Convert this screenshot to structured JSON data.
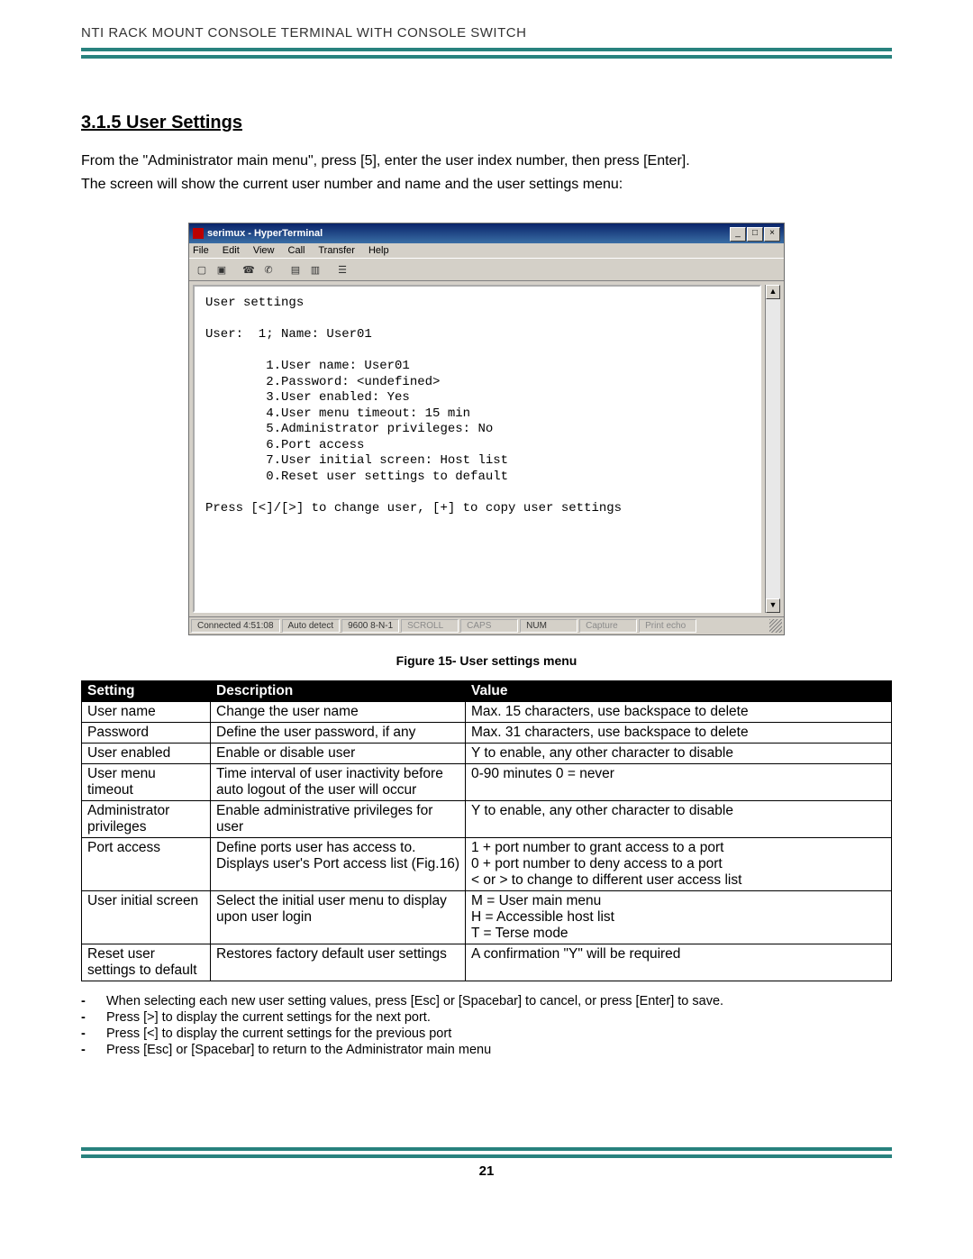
{
  "header": "NTI RACK MOUNT CONSOLE TERMINAL WITH CONSOLE SWITCH",
  "section_heading": "3.1.5 User Settings",
  "intro_line1": "From the \"Administrator main menu\", press [5], enter the user index number, then press [Enter].",
  "intro_line2": "The screen will show the current user number and name and the user settings menu:",
  "hyperterminal": {
    "title": "serimux - HyperTerminal",
    "menu": {
      "file": "File",
      "edit": "Edit",
      "view": "View",
      "call": "Call",
      "transfer": "Transfer",
      "help": "Help"
    },
    "terminal_text": "User settings\n\nUser:  1; Name: User01\n\n        1.User name: User01\n        2.Password: <undefined>\n        3.User enabled: Yes\n        4.User menu timeout: 15 min\n        5.Administrator privileges: No\n        6.Port access\n        7.User initial screen: Host list\n        0.Reset user settings to default\n\nPress [<]/[>] to change user, [+] to copy user settings",
    "status": {
      "connected": "Connected 4:51:08",
      "autodetect": "Auto detect",
      "baud": "9600 8-N-1",
      "scroll": "SCROLL",
      "caps": "CAPS",
      "num": "NUM",
      "capture": "Capture",
      "printecho": "Print echo"
    }
  },
  "figure_caption": "Figure 15- User settings menu",
  "table_header": {
    "c1": "Setting",
    "c2": "Description",
    "c3": "Value"
  },
  "rows": [
    {
      "setting": "User name",
      "desc": "Change the user name",
      "value": "Max. 15 characters, use backspace to delete"
    },
    {
      "setting": "Password",
      "desc": "Define the user password, if any",
      "value": "Max. 31 characters, use backspace to delete"
    },
    {
      "setting": "User enabled",
      "desc": "Enable or disable user",
      "value": "Y to enable, any other character to disable"
    },
    {
      "setting": "User menu timeout",
      "desc": "Time interval of user inactivity before auto logout of the user will occur",
      "value": "0-90 minutes   0 = never"
    },
    {
      "setting": "Administrator privileges",
      "desc": "Enable administrative privileges for user",
      "value": "Y to enable, any other character to disable"
    },
    {
      "setting": "Port access",
      "desc": "Define ports user has access to. Displays user's Port access list (Fig.16)",
      "value": "1 + port number to grant access to a port\n0 + port number to deny access to a port\n< or > to change to different user access list"
    },
    {
      "setting": "User initial screen",
      "desc": "Select the initial user menu to display upon user login",
      "value": "M = User main menu\nH = Accessible host list\nT = Terse mode"
    },
    {
      "setting": "Reset user settings to default",
      "desc": "Restores factory default user settings",
      "value": "A confirmation \"Y\"  will be required"
    }
  ],
  "notes": [
    "When selecting each new user setting values,  press [Esc] or [Spacebar] to cancel,   or press [Enter] to save.",
    "Press [>] to display the current settings for the next port.",
    "Press [<] to display the current settings for the previous port",
    "Press [Esc] or [Spacebar] to return to the Administrator main menu"
  ],
  "page_number": "21"
}
